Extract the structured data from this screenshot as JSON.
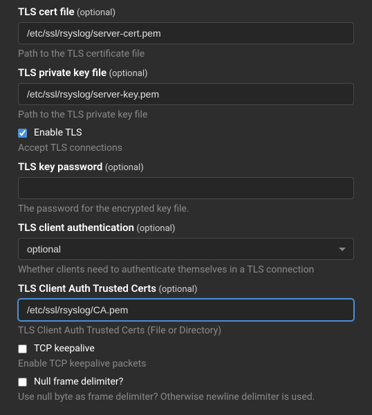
{
  "tlsCertFile": {
    "label": "TLS cert file",
    "optional": "(optional)",
    "value": "/etc/ssl/rsyslog/server-cert.pem",
    "help": "Path to the TLS certificate file"
  },
  "tlsPrivateKeyFile": {
    "label": "TLS private key file",
    "optional": "(optional)",
    "value": "/etc/ssl/rsyslog/server-key.pem",
    "help": "Path to the TLS private key file"
  },
  "enableTls": {
    "label": "Enable TLS",
    "checked": true,
    "help": "Accept TLS connections"
  },
  "tlsKeyPassword": {
    "label": "TLS key password",
    "optional": "(optional)",
    "value": "",
    "help": "The password for the encrypted key file."
  },
  "tlsClientAuth": {
    "label": "TLS client authentication",
    "optional": "(optional)",
    "selected": "optional",
    "help": "Whether clients need to authenticate themselves in a TLS connection"
  },
  "tlsClientAuthTrustedCerts": {
    "label": "TLS Client Auth Trusted Certs",
    "optional": "(optional)",
    "value": "/etc/ssl/rsyslog/CA.pem",
    "help": "TLS Client Auth Trusted Certs (File or Directory)"
  },
  "tcpKeepalive": {
    "label": "TCP keepalive",
    "checked": false,
    "help": "Enable TCP keepalive packets"
  },
  "nullFrameDelimiter": {
    "label": "Null frame delimiter?",
    "checked": false,
    "help": "Use null byte as frame delimiter? Otherwise newline delimiter is used."
  }
}
